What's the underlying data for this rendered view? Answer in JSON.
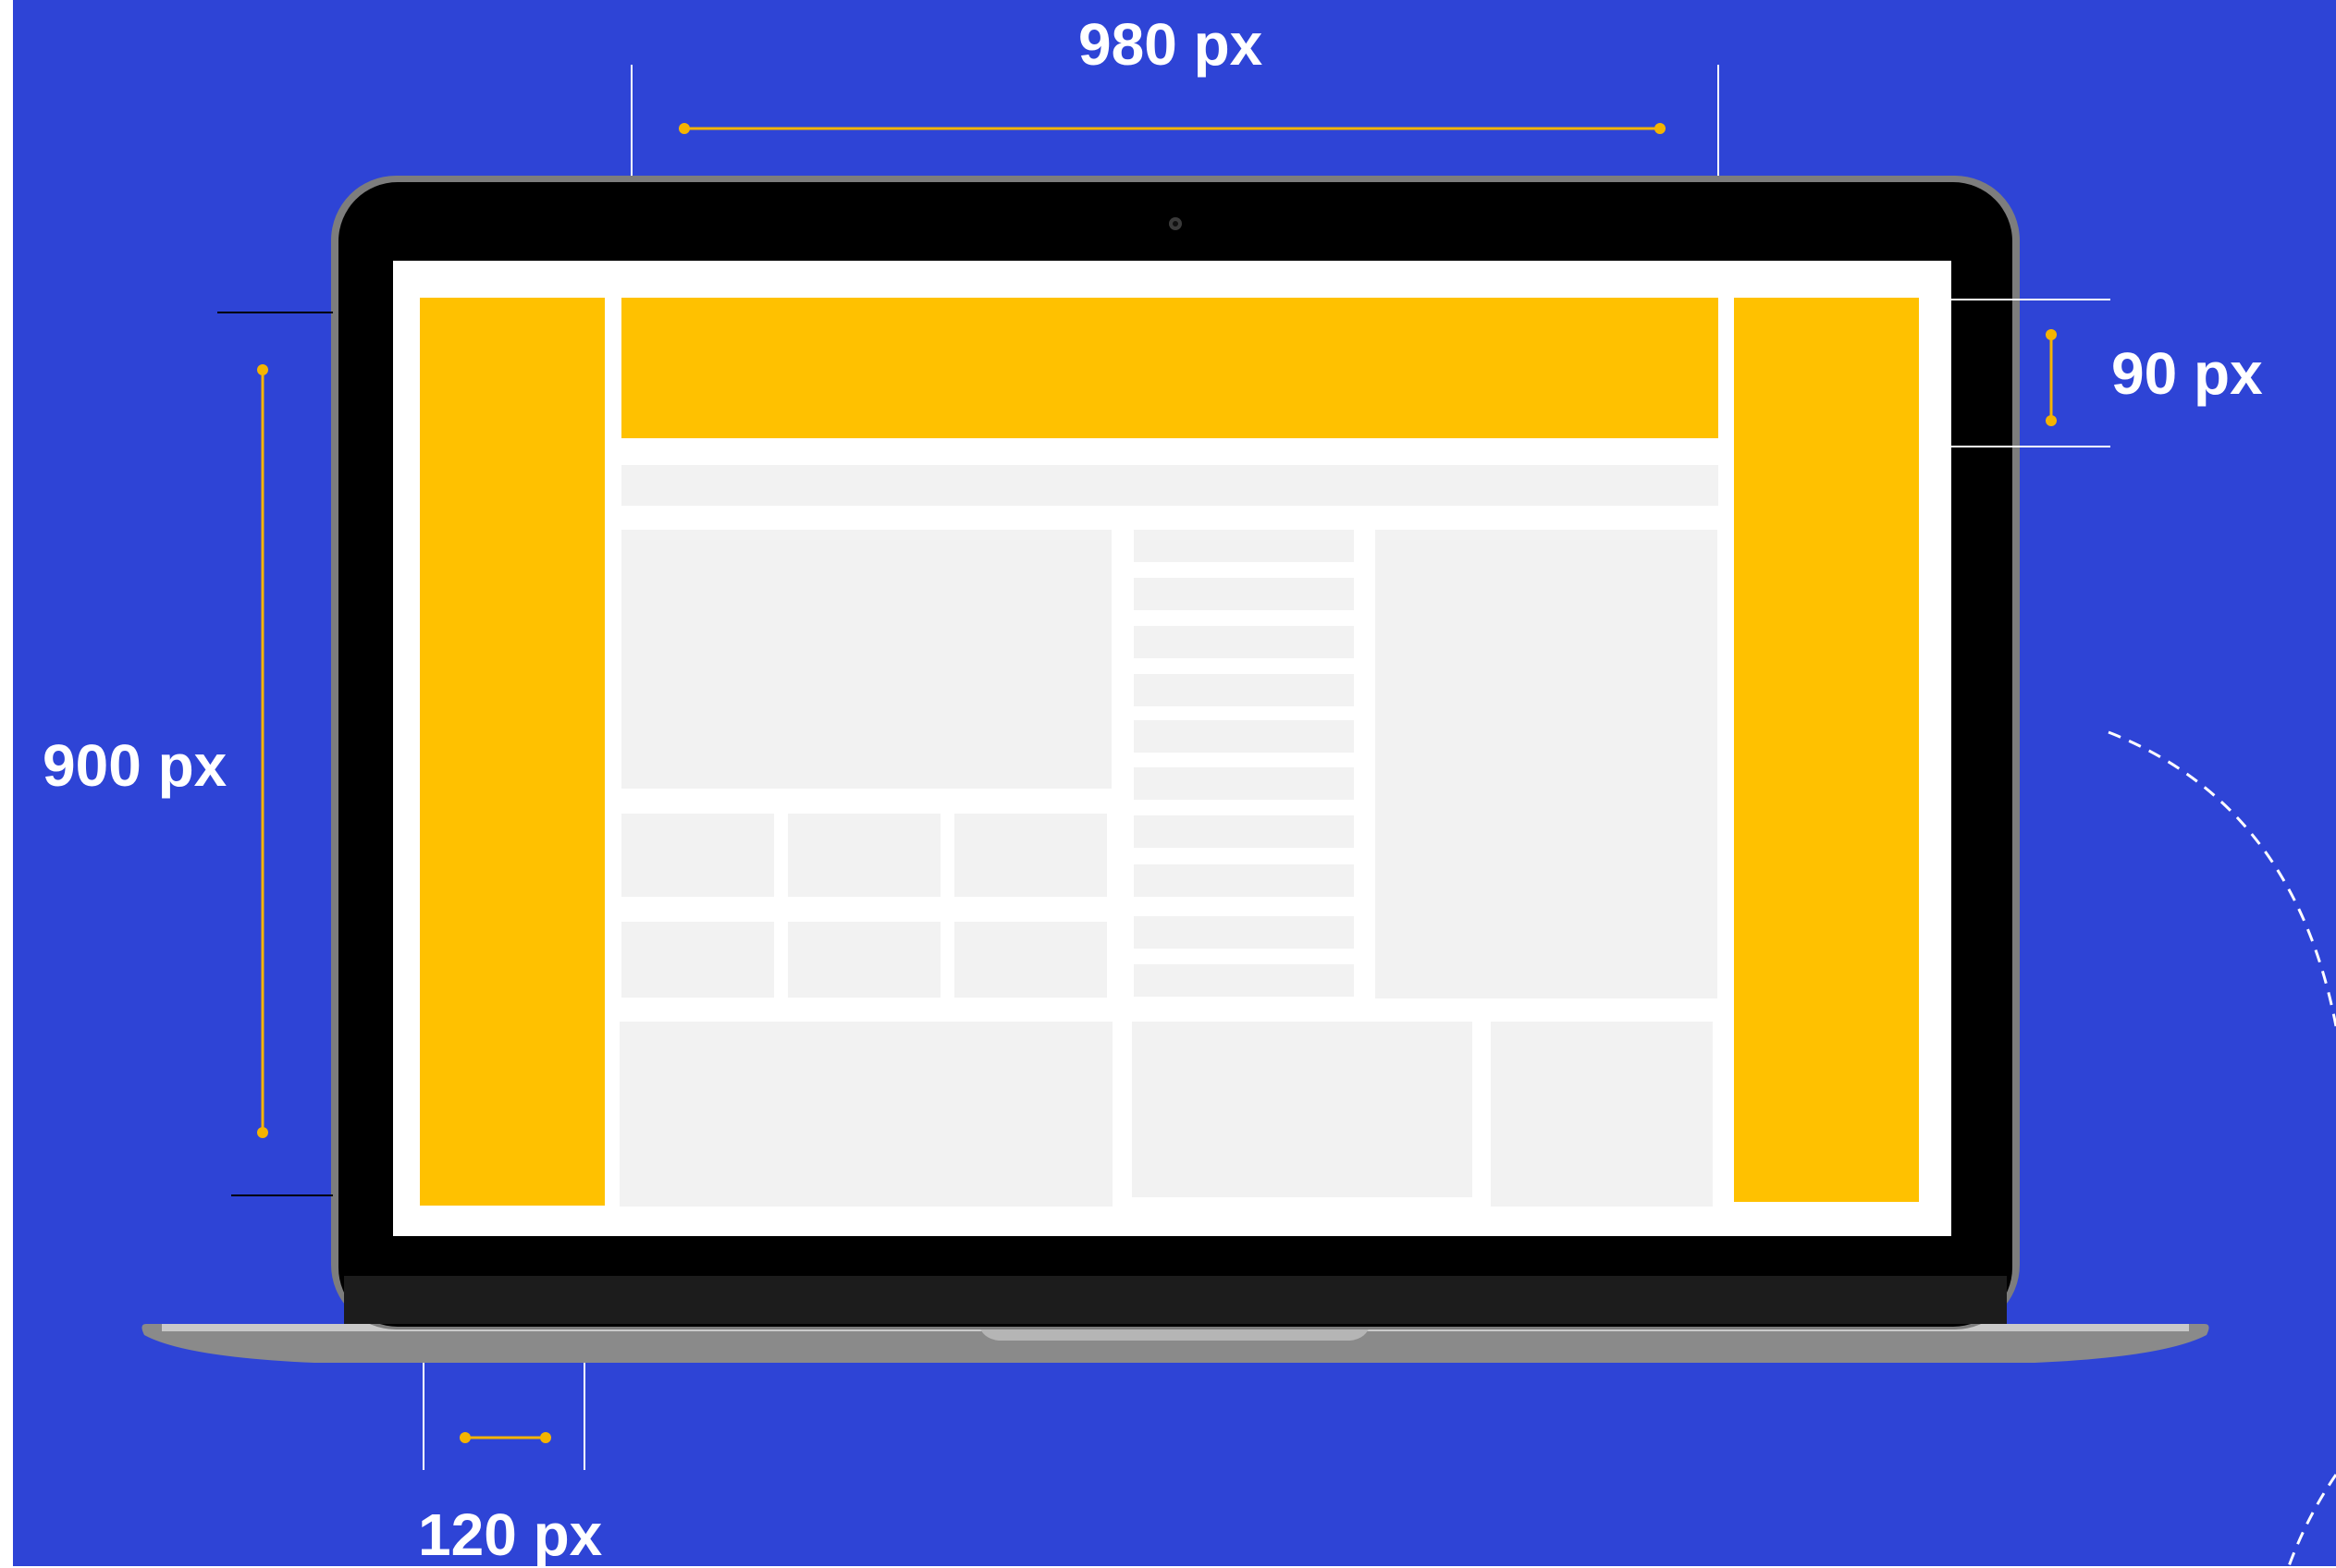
{
  "colors": {
    "background": "#2e44d6",
    "ad_slot": "#ffc100",
    "placeholder": "#f2f2f2",
    "screen_bg": "#ffffff",
    "bezel": "#000000",
    "laptop_base": "#8a8a8a",
    "measure_line": "#f5b400",
    "extension_line": "#ffffff"
  },
  "dimensions": {
    "top_width": "980 px",
    "left_height": "900 px",
    "right_height": "90 px",
    "bottom_width": "120 px"
  }
}
